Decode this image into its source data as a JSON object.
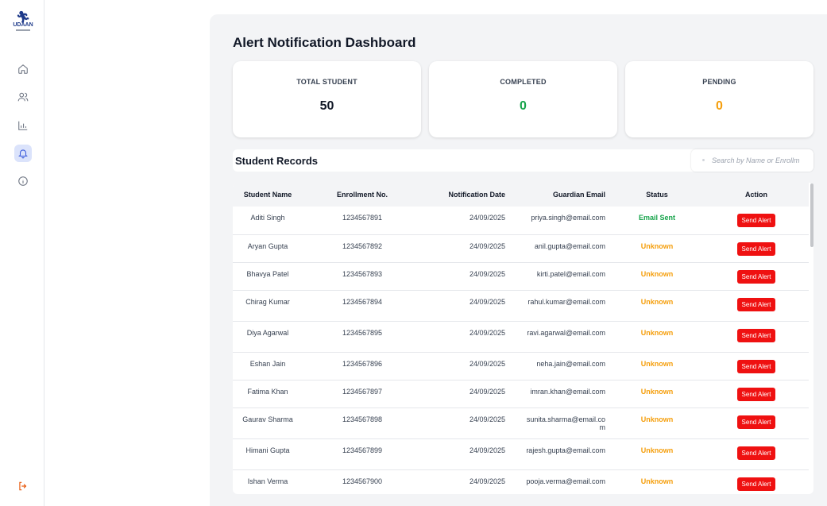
{
  "sidebar": {
    "logo_text": "UDAAN",
    "items": [
      {
        "icon": "home-icon"
      },
      {
        "icon": "users-icon"
      },
      {
        "icon": "bar-chart-icon"
      },
      {
        "icon": "bell-icon",
        "active": true
      },
      {
        "icon": "info-icon"
      }
    ],
    "logout_icon": "logout-icon"
  },
  "page": {
    "title": "Alert Notification Dashboard"
  },
  "stats": [
    {
      "label": "TOTAL STUDENT",
      "value": "50",
      "color": "#111827"
    },
    {
      "label": "COMPLETED",
      "value": "0",
      "color": "#16a34a"
    },
    {
      "label": "PENDING",
      "value": "0",
      "color": "#f59e0b"
    }
  ],
  "records": {
    "title": "Student Records",
    "search_placeholder": "Search by Name or Enrollm",
    "columns": [
      "Student Name",
      "Enrollment No.",
      "Notification Date",
      "Guardian Email",
      "Status",
      "Action"
    ],
    "rows": [
      {
        "name": "Aditi Singh",
        "enrollment": "1234567891",
        "date": "24/09/2025",
        "email": "priya.singh@email.com",
        "status": "Email Sent",
        "action": "Send Alert"
      },
      {
        "name": "Aryan Gupta",
        "enrollment": "1234567892",
        "date": "24/09/2025",
        "email": "anil.gupta@email.com",
        "status": "Unknown",
        "action": "Send Alert"
      },
      {
        "name": "Bhavya Patel",
        "enrollment": "1234567893",
        "date": "24/09/2025",
        "email": "kirti.patel@email.com",
        "status": "Unknown",
        "action": "Send Alert"
      },
      {
        "name": "Chirag Kumar",
        "enrollment": "1234567894",
        "date": "24/09/2025",
        "email": "rahul.kumar@email.com",
        "status": "Unknown",
        "action": "Send Alert"
      },
      {
        "name": "Diya Agarwal",
        "enrollment": "1234567895",
        "date": "24/09/2025",
        "email": "ravi.agarwal@email.com",
        "status": "Unknown",
        "action": "Send Alert"
      },
      {
        "name": "Eshan Jain",
        "enrollment": "1234567896",
        "date": "24/09/2025",
        "email": "neha.jain@email.com",
        "status": "Unknown",
        "action": "Send Alert"
      },
      {
        "name": "Fatima Khan",
        "enrollment": "1234567897",
        "date": "24/09/2025",
        "email": "imran.khan@email.com",
        "status": "Unknown",
        "action": "Send Alert"
      },
      {
        "name": "Gaurav Sharma",
        "enrollment": "1234567898",
        "date": "24/09/2025",
        "email": "sunita.sharma@email.com",
        "status": "Unknown",
        "action": "Send Alert"
      },
      {
        "name": "Himani Gupta",
        "enrollment": "1234567899",
        "date": "24/09/2025",
        "email": "rajesh.gupta@email.com",
        "status": "Unknown",
        "action": "Send Alert"
      },
      {
        "name": "Ishan Verma",
        "enrollment": "1234567900",
        "date": "24/09/2025",
        "email": "pooja.verma@email.com",
        "status": "Unknown",
        "action": "Send Alert"
      }
    ]
  },
  "colors": {
    "status_sent": "#16a34a",
    "status_unknown": "#f59e0b",
    "alert_button": "#ef1111",
    "active_nav": "#dbe3fb"
  }
}
